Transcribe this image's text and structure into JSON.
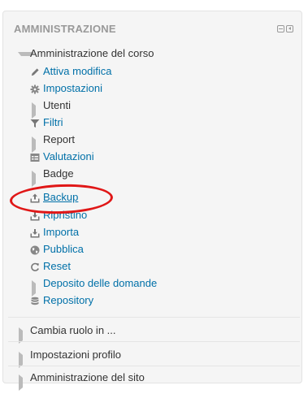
{
  "block": {
    "title": "AMMINISTRAZIONE",
    "controls": {
      "minimize_icon": "minimize-icon",
      "dock_icon": "dock-icon"
    }
  },
  "course_admin": {
    "label": "Amministrazione del corso",
    "items": [
      {
        "label": "Attiva modifica",
        "icon": "pencil-icon",
        "type": "link"
      },
      {
        "label": "Impostazioni",
        "icon": "gear-icon",
        "type": "link"
      },
      {
        "label": "Utenti",
        "icon": "expand-arrow-icon",
        "type": "branch"
      },
      {
        "label": "Filtri",
        "icon": "filter-icon",
        "type": "link"
      },
      {
        "label": "Report",
        "icon": "expand-arrow-icon",
        "type": "branch"
      },
      {
        "label": "Valutazioni",
        "icon": "table-icon",
        "type": "link"
      },
      {
        "label": "Badge",
        "icon": "expand-arrow-icon",
        "type": "branch"
      },
      {
        "label": "Backup",
        "icon": "upload-icon",
        "type": "link",
        "highlighted": true
      },
      {
        "label": "Ripristino",
        "icon": "restore-icon",
        "type": "link"
      },
      {
        "label": "Importa",
        "icon": "import-icon",
        "type": "link"
      },
      {
        "label": "Pubblica",
        "icon": "globe-icon",
        "type": "link"
      },
      {
        "label": "Reset",
        "icon": "reset-icon",
        "type": "link"
      },
      {
        "label": "Deposito delle domande",
        "icon": "expand-arrow-icon",
        "type": "branch"
      },
      {
        "label": "Repository",
        "icon": "database-icon",
        "type": "link"
      }
    ]
  },
  "other_sections": [
    {
      "label": "Cambia ruolo in ..."
    },
    {
      "label": "Impostazioni profilo"
    },
    {
      "label": "Amministrazione del sito"
    }
  ],
  "colors": {
    "link": "#0070a8",
    "highlight": "#e01717",
    "header": "#999999"
  }
}
